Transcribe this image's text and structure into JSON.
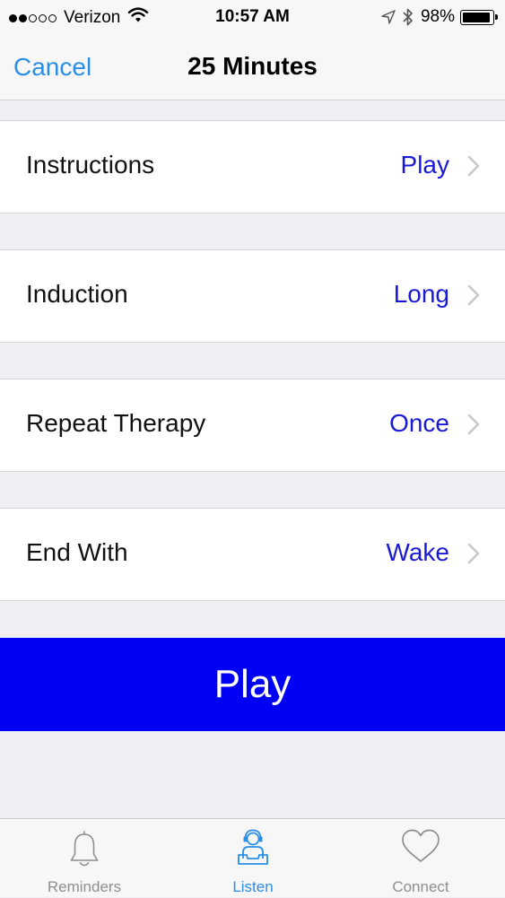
{
  "status_bar": {
    "signal_full": 2,
    "signal_total": 5,
    "carrier": "Verizon",
    "time": "10:57 AM",
    "battery_percent": "98%",
    "battery_level": 0.98,
    "icons": [
      "wifi-icon",
      "location-arrow-icon",
      "bluetooth-icon",
      "battery-icon"
    ]
  },
  "nav": {
    "cancel_label": "Cancel",
    "title": "25 Minutes"
  },
  "settings": [
    {
      "label": "Instructions",
      "value": "Play"
    },
    {
      "label": "Induction",
      "value": "Long"
    },
    {
      "label": "Repeat Therapy",
      "value": "Once"
    },
    {
      "label": "End With",
      "value": "Wake"
    }
  ],
  "play_button": {
    "label": "Play"
  },
  "tabs": [
    {
      "label": "Reminders",
      "icon": "bell-icon",
      "active": false
    },
    {
      "label": "Listen",
      "icon": "listener-headset-icon",
      "active": true
    },
    {
      "label": "Connect",
      "icon": "heart-icon",
      "active": false
    }
  ],
  "colors": {
    "accent": "#2b8ee6",
    "value_text": "#1a1ad6",
    "play_button": "#0000f5",
    "background": "#efeff4"
  }
}
